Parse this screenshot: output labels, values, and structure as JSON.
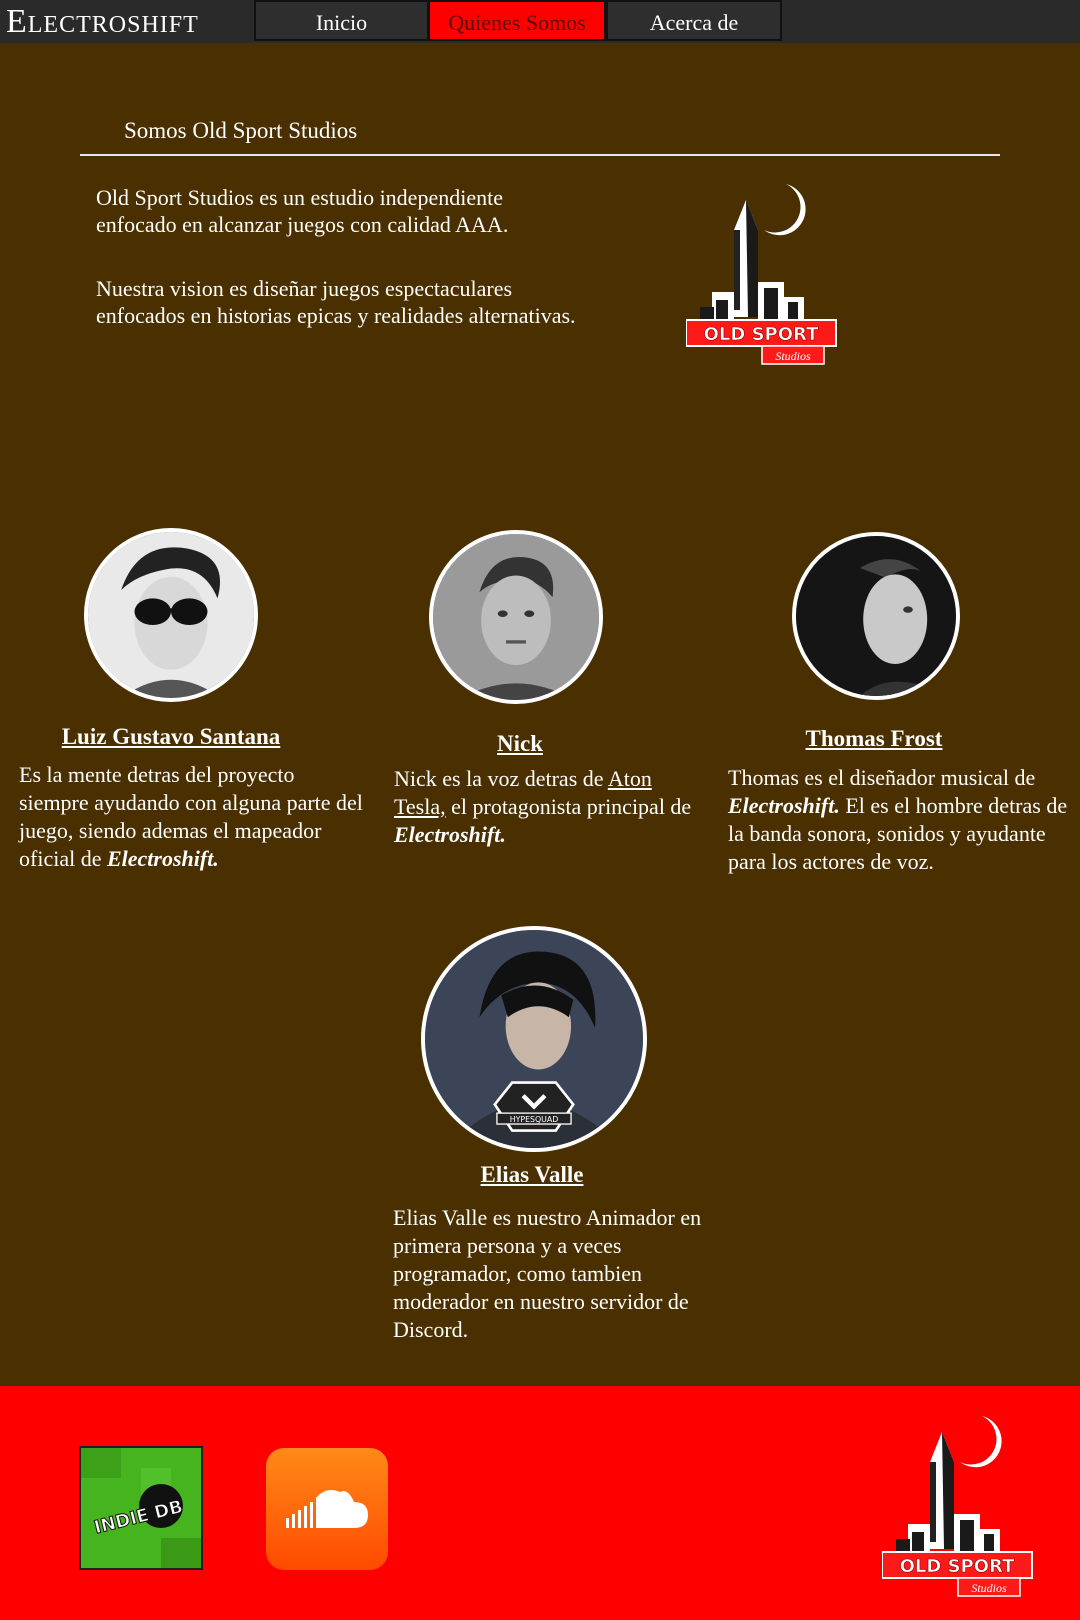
{
  "header": {
    "brand": "Electroshift",
    "tabs": [
      {
        "label": "Inicio"
      },
      {
        "label": "Quienes Somos"
      },
      {
        "label": "Acerca de"
      }
    ]
  },
  "intro": {
    "heading": "Somos Old Sport Studios",
    "paragraph1": "Old Sport Studios es un estudio independiente enfocado en alcanzar juegos con calidad AAA.",
    "paragraph2": "Nuestra vision es diseñar juegos espectaculares enfocados en historias epicas y realidades alternativas."
  },
  "logo": {
    "name": "OLD SPORT",
    "tagline": "Studios"
  },
  "team": [
    {
      "name": "Luiz Gustavo Santana",
      "bio_text": "Es la mente detras del proyecto siempre ayudando con alguna parte del juego, siendo ademas el mapeador oficial de ",
      "bio_emphasis": "Electroshift."
    },
    {
      "name": "Nick",
      "bio_pre": "Nick es la voz detras de ",
      "bio_link": "Aton Tesla,",
      "bio_mid": " el protagonista principal de ",
      "bio_emphasis": "Electroshift."
    },
    {
      "name": "Thomas Frost",
      "bio_pre": "Thomas es el diseñador musical de ",
      "bio_emphasis": "Electroshift.",
      "bio_post": " El es el hombre detras de la banda sonora, sonidos y ayudante para los actores de voz."
    },
    {
      "name": "Elias Valle",
      "bio_text": "Elias Valle es nuestro Animador en primera persona y a veces programador, como tambien moderador en nuestro servidor de Discord.",
      "badge_text": "HYPESQUAD"
    }
  ],
  "footer": {
    "indiedb_label": "INDIE DB",
    "colors": {
      "footer_bg": "#ff0000",
      "page_bg": "#4a2f00"
    }
  }
}
